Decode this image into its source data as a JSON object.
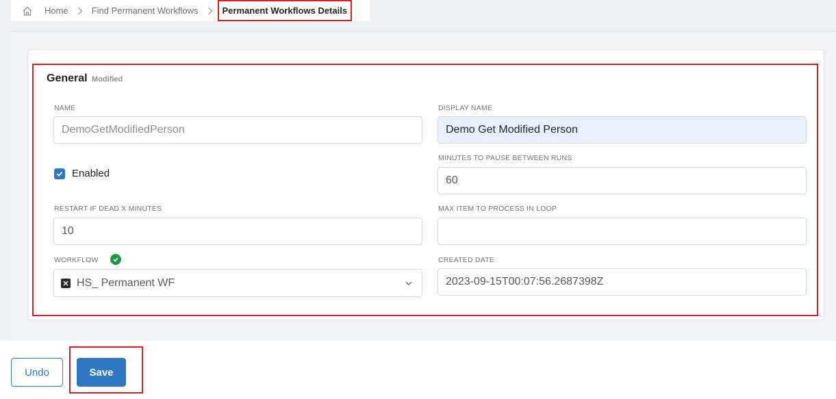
{
  "breadcrumb": {
    "home": "Home",
    "find": "Find Permanent Workflows",
    "current": "Permanent Workflows Details"
  },
  "section": {
    "title": "General",
    "badge": "Modified"
  },
  "fields": {
    "name_label": "NAME",
    "name_value": "DemoGetModifiedPerson",
    "display_name_label": "DISPLAY NAME",
    "display_name_value": "Demo Get Modified Person",
    "enabled_label": "Enabled",
    "enabled_checked": true,
    "minutes_pause_label": "MINUTES TO PAUSE BETWEEN RUNS",
    "minutes_pause_value": "60",
    "restart_label": "RESTART IF DEAD X MINUTES",
    "restart_value": "10",
    "max_item_label": "MAX ITEM TO PROCESS IN LOOP",
    "max_item_value": "",
    "workflow_label": "WORKFLOW",
    "workflow_value": "HS_ Permanent WF",
    "created_label": "CREATED DATE",
    "created_value": "2023-09-15T00:07:56.2687398Z"
  },
  "buttons": {
    "undo": "Undo",
    "save": "Save"
  },
  "colors": {
    "accent": "#2f79c2",
    "highlight": "#d42026",
    "success": "#1a9a3f"
  }
}
